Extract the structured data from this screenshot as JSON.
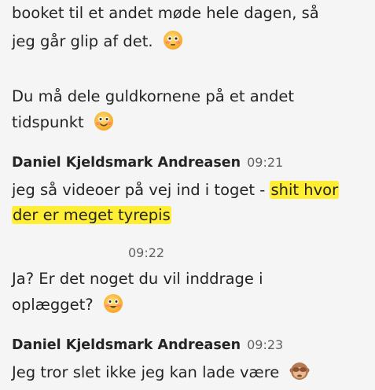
{
  "messages": {
    "m1": {
      "line1": "booket til et andet møde hele dagen, så",
      "line2": "jeg går glip af det."
    },
    "m2": {
      "line1": "Du må dele guldkornene på et andet",
      "line2": "tidspunkt"
    },
    "m3": {
      "sender": "Daniel Kjeldsmark Andreasen",
      "time": "09:21",
      "line1_plain": "jeg så videoer på vej ind i toget - ",
      "line1_highlight": "shit hvor",
      "line2_highlight": "der er meget tyrepis"
    },
    "m4": {
      "time": "09:22",
      "line1": "Ja? Er det noget du vil inddrage i",
      "line2": "oplægget?"
    },
    "m5": {
      "sender": "Daniel Kjeldsmark Andreasen",
      "time": "09:23",
      "line1": "Jeg tror slet ikke jeg kan lade være"
    }
  },
  "icons": {
    "emoji1": "flushed-face-icon",
    "emoji2": "smiling-face-icon",
    "emoji3": "grinning-face-icon",
    "emoji4": "see-no-evil-monkey-icon"
  },
  "colors": {
    "background": "#f5f5f5",
    "text": "#242424",
    "timestamp": "#616161",
    "highlight": "#ffee33"
  }
}
